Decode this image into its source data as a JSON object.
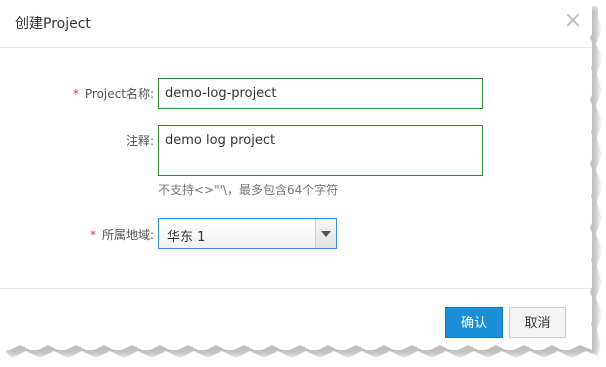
{
  "dialog": {
    "title": "创建Project",
    "close_symbol": "×"
  },
  "form": {
    "project_name": {
      "required_mark": "*",
      "label": "Project名称:",
      "value": "demo-log-project"
    },
    "comment": {
      "label": "注释:",
      "value": "demo log project",
      "hint": "不支持<>\"'\\，最多包含64个字符"
    },
    "region": {
      "required_mark": "*",
      "label": "所属地域:",
      "selected": "华东 1"
    }
  },
  "footer": {
    "confirm_label": "确认",
    "cancel_label": "取消"
  },
  "colors": {
    "primary": "#1c8ed7",
    "valid_border": "#2e8b2e",
    "focus_border": "#3a8ee6",
    "required": "#e4393c"
  },
  "icons": {
    "close": "close-icon",
    "dropdown": "chevron-down-icon"
  }
}
